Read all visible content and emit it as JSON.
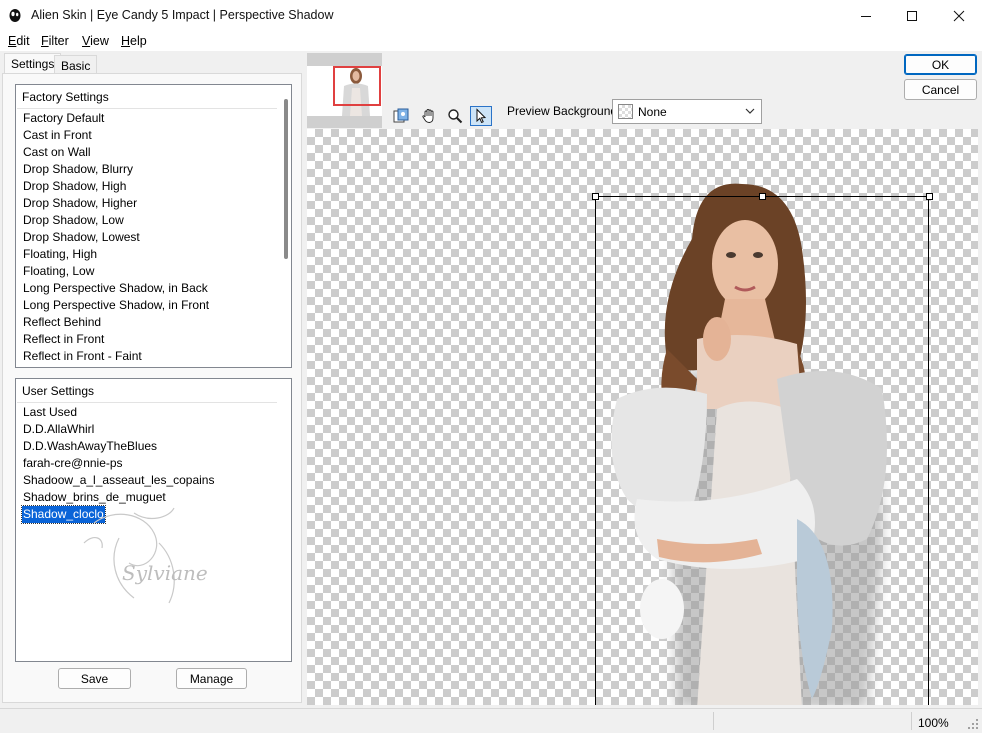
{
  "window": {
    "title": "Alien Skin | Eye Candy 5 Impact | Perspective Shadow"
  },
  "menu": {
    "items": [
      {
        "underline": "E",
        "rest": "dit"
      },
      {
        "underline": "F",
        "rest": "ilter"
      },
      {
        "underline": "V",
        "rest": "iew"
      },
      {
        "underline": "H",
        "rest": "elp"
      }
    ]
  },
  "tabs": {
    "settings": "Settings",
    "basic": "Basic"
  },
  "factory": {
    "header": "Factory Settings",
    "items": [
      "Factory Default",
      "Cast in Front",
      "Cast on Wall",
      "Drop Shadow, Blurry",
      "Drop Shadow, High",
      "Drop Shadow, Higher",
      "Drop Shadow, Low",
      "Drop Shadow, Lowest",
      "Floating, High",
      "Floating, Low",
      "Long Perspective Shadow, in Back",
      "Long Perspective Shadow, in Front",
      "Reflect Behind",
      "Reflect in Front",
      "Reflect in Front - Faint"
    ]
  },
  "user": {
    "header": "User Settings",
    "items": [
      "Last Used",
      "D.D.AllaWhirl",
      "D.D.WashAwayTheBlues",
      "farah-cre@nnie-ps",
      "Shadoow_a_l_asseaut_les_copains",
      "Shadow_brins_de_muguet",
      "Shadow_cloclo"
    ],
    "selected_index": 6,
    "watermark_text": "Sylviane"
  },
  "buttons": {
    "save": "Save",
    "manage": "Manage",
    "ok": "OK",
    "cancel": "Cancel"
  },
  "preview_background": {
    "label": "Preview Background:",
    "value": "None"
  },
  "status": {
    "zoom": "100%"
  },
  "colors": {
    "selection": "#0a64d8",
    "thumb_frame": "#e04040"
  }
}
